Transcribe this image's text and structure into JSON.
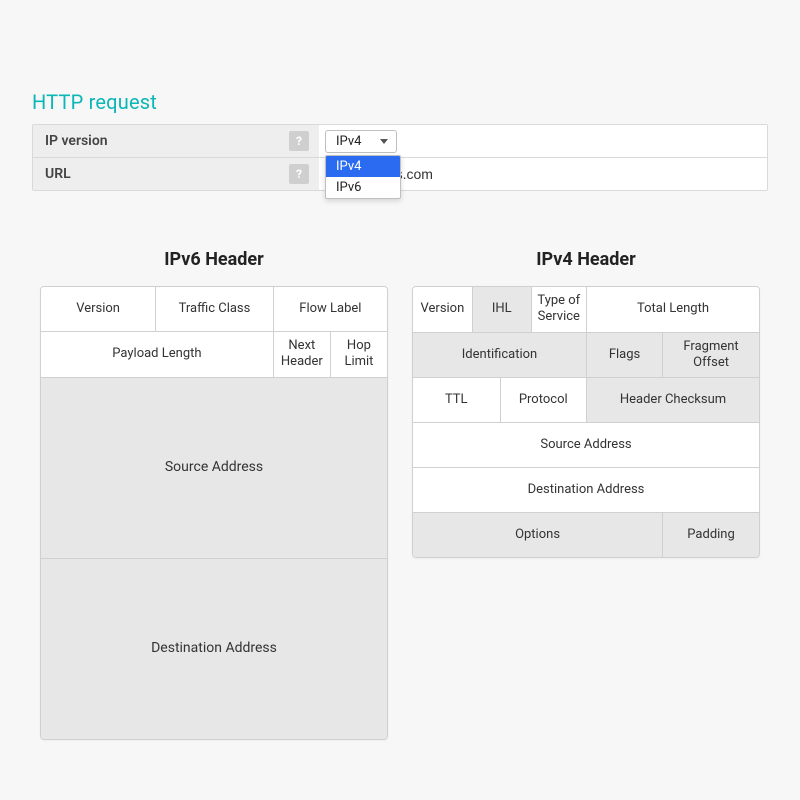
{
  "section_title": "HTTP request",
  "form": {
    "ip_version": {
      "label": "IP version",
      "help": "?",
      "selected": "IPv4",
      "options": [
        "IPv4",
        "IPv6"
      ]
    },
    "url": {
      "label": "URL",
      "help": "?",
      "value": "acticresorts.com"
    }
  },
  "ipv6": {
    "title": "IPv6 Header",
    "cells": {
      "version": "Version",
      "traffic_class": "Traffic Class",
      "flow_label": "Flow Label",
      "payload_length": "Payload Length",
      "next_header": "Next Header",
      "hop_limit": "Hop Limit",
      "source_address": "Source Address",
      "destination_address": "Destination Address"
    }
  },
  "ipv4": {
    "title": "IPv4 Header",
    "cells": {
      "version": "Version",
      "ihl": "IHL",
      "tos": "Type of Service",
      "total_length": "Total Length",
      "identification": "Identification",
      "flags": "Flags",
      "fragment_offset": "Fragment Offset",
      "ttl": "TTL",
      "protocol": "Protocol",
      "header_checksum": "Header Checksum",
      "source_address": "Source Address",
      "destination_address": "Destination Address",
      "options": "Options",
      "padding": "Padding"
    }
  }
}
